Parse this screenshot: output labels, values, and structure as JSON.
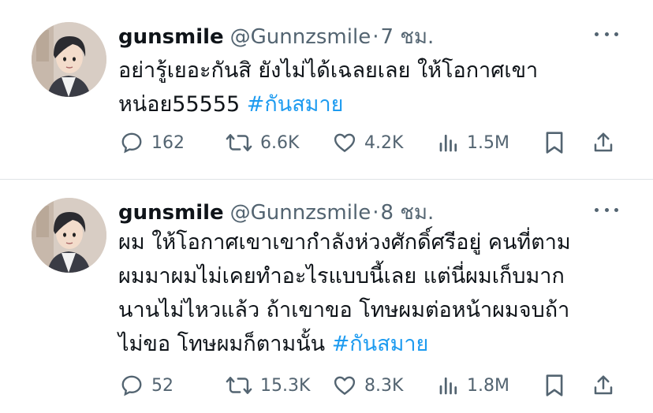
{
  "tweets": [
    {
      "display_name": "gunsmile",
      "handle": "@Gunnzsmile",
      "separator": "·",
      "time": "7 ชม.",
      "text_lines": [
        "อย่ารู้เยอะกันสิ ยังไม่ได้เฉลยเลย ให้โอกาศเขา",
        "หน่อย55555 "
      ],
      "hashtag": "#กันสมาย",
      "replies": "162",
      "retweets": "6.6K",
      "likes": "4.2K",
      "views": "1.5M"
    },
    {
      "display_name": "gunsmile",
      "handle": "@Gunnzsmile",
      "separator": "·",
      "time": "8 ชม.",
      "text_lines": [
        "ผม ให้โอกาศเขาเขากำลังห่วงศักดิ์ศรีอยู่ คนที่ตาม",
        "ผมมาผมไม่เคยทำอะไรแบบนี้เลย แต่นี่ผมเก็บมาก",
        "นานไม่ไหวแล้ว ถ้าเขาขอ โทษผมต่อหน้าผมจบถ้า",
        "ไม่ขอ โทษผมก็ตามนั้น  "
      ],
      "hashtag": "#กันสมาย",
      "replies": "52",
      "retweets": "15.3K",
      "likes": "8.3K",
      "views": "1.8M"
    }
  ],
  "colors": {
    "text": "#0f1419",
    "secondary": "#536471",
    "accent": "#1d9bf0"
  },
  "icons": [
    "more-icon",
    "reply-icon",
    "retweet-icon",
    "like-icon",
    "views-icon",
    "bookmark-icon",
    "share-icon"
  ]
}
